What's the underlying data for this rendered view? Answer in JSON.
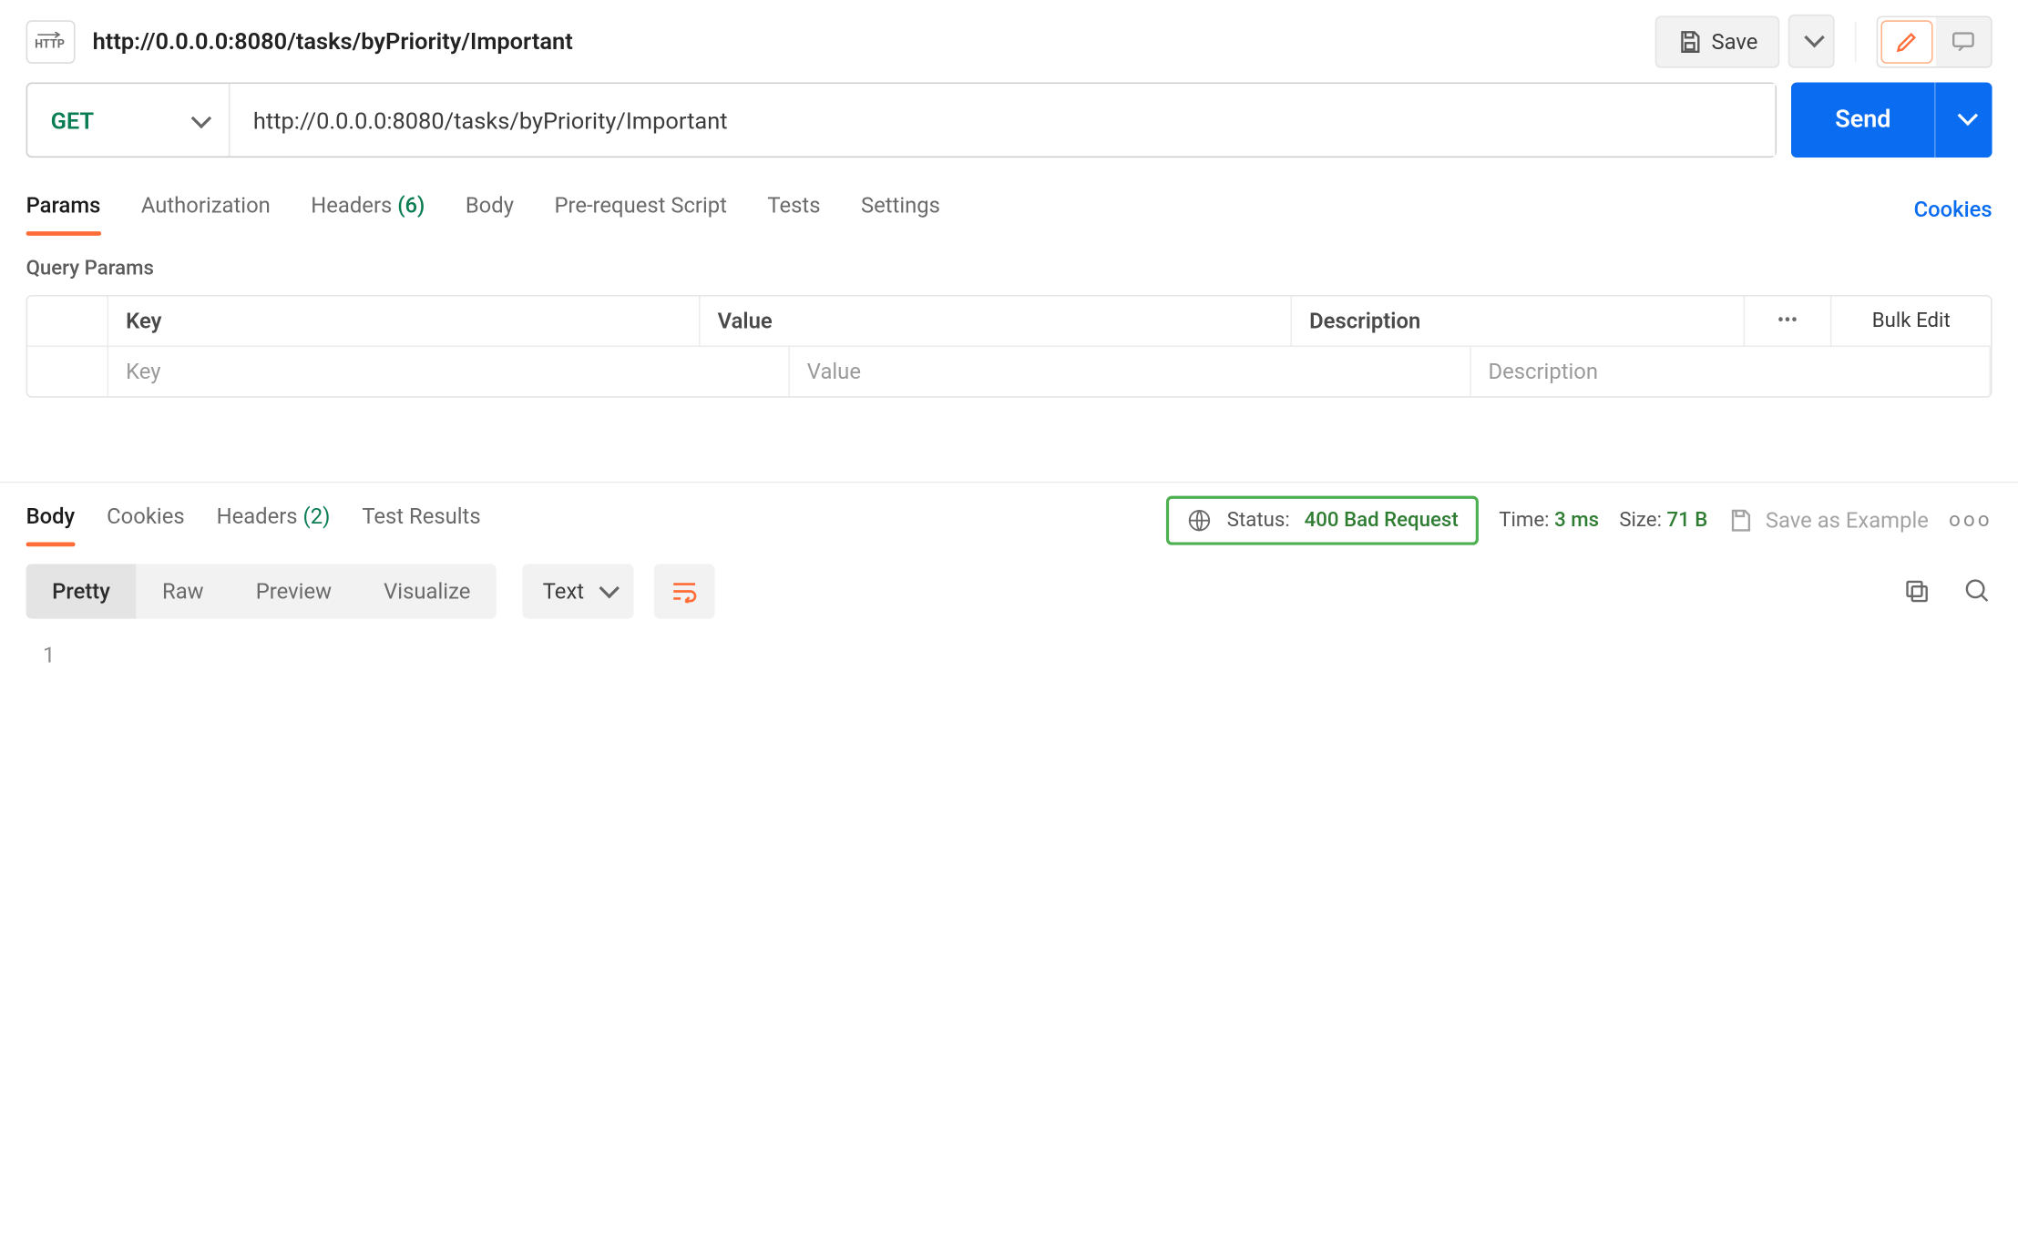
{
  "header": {
    "title": "http://0.0.0.0:8080/tasks/byPriority/Important",
    "save_label": "Save"
  },
  "request": {
    "method": "GET",
    "url": "http://0.0.0.0:8080/tasks/byPriority/Important",
    "send_label": "Send"
  },
  "tabs": {
    "params": "Params",
    "authorization": "Authorization",
    "headers": "Headers",
    "headers_count": "(6)",
    "body": "Body",
    "pre_request": "Pre-request Script",
    "tests": "Tests",
    "settings": "Settings",
    "cookies": "Cookies"
  },
  "query_params": {
    "section_label": "Query Params",
    "cols": {
      "key": "Key",
      "value": "Value",
      "description": "Description"
    },
    "bulk_edit": "Bulk Edit",
    "placeholders": {
      "key": "Key",
      "value": "Value",
      "description": "Description"
    }
  },
  "response": {
    "tabs": {
      "body": "Body",
      "cookies": "Cookies",
      "headers": "Headers",
      "headers_count": "(2)",
      "test_results": "Test Results"
    },
    "status_label": "Status:",
    "status_value": "400 Bad Request",
    "time_label": "Time:",
    "time_value": "3 ms",
    "size_label": "Size:",
    "size_value": "71 B",
    "save_example": "Save as Example",
    "view_modes": {
      "pretty": "Pretty",
      "raw": "Raw",
      "preview": "Preview",
      "visualize": "Visualize"
    },
    "format": "Text",
    "line_number": "1",
    "body_text": ""
  }
}
